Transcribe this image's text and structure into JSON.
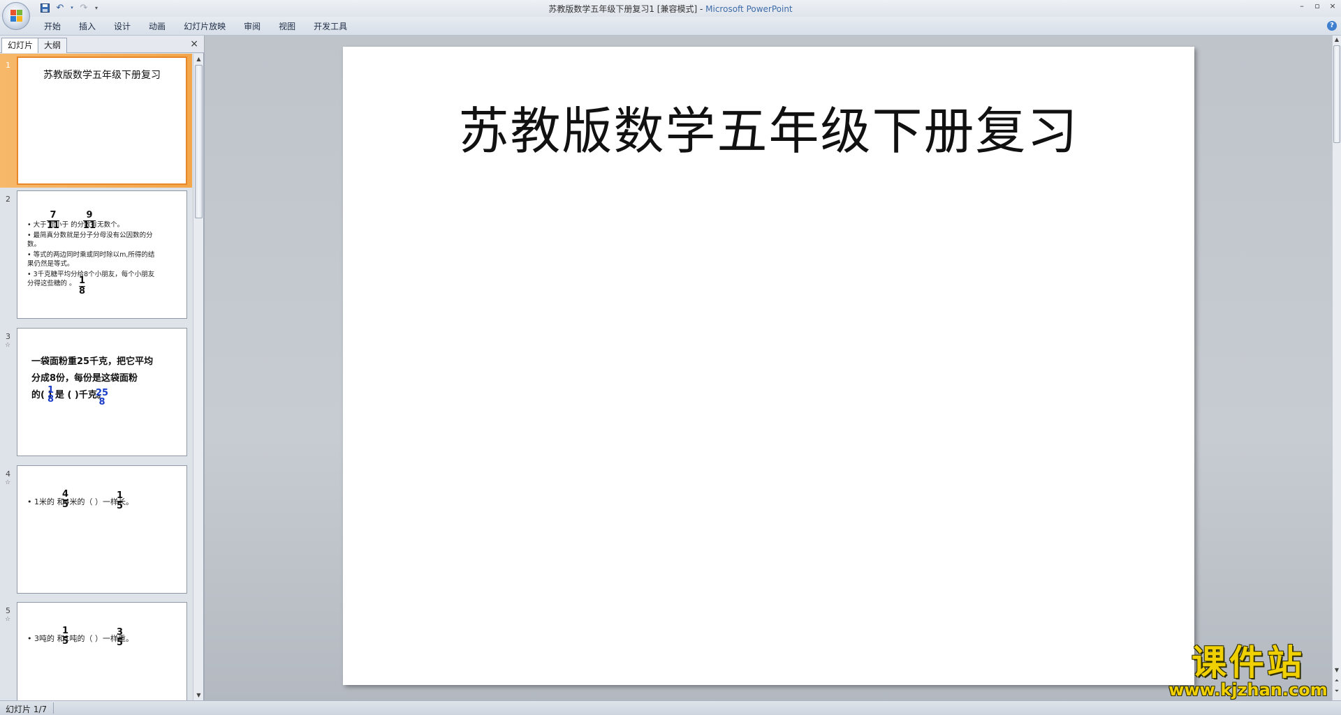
{
  "window": {
    "title_doc": "苏教版数学五年级下册复习1 [兼容模式] - ",
    "title_app": "Microsoft PowerPoint",
    "controls": [
      "–",
      "▫",
      "×"
    ]
  },
  "ribbon": {
    "tabs": [
      "开始",
      "插入",
      "设计",
      "动画",
      "幻灯片放映",
      "审阅",
      "视图",
      "开发工具"
    ],
    "help": "?"
  },
  "left_pane": {
    "tabs": [
      "幻灯片",
      "大纲"
    ],
    "close": "×",
    "thumbnails": [
      {
        "number": "1",
        "title": "苏教版数学五年级下册复习"
      },
      {
        "number": "2",
        "lines": [
          "• 大于      而小于      的分数有无数个。",
          "• 最简真分数就是分子分母没有公因数的分",
          "   数。",
          "• 等式的两边同时乘或同时除以m,所得的结",
          "   果仍然是等式。",
          "• 3千克糖平均分给8个小朋友，每个小朋友",
          "   分得这些糖的    。"
        ],
        "fractions": [
          [
            "7",
            "11"
          ],
          [
            "9",
            "11"
          ],
          [
            "1",
            "8"
          ]
        ]
      },
      {
        "number": "3",
        "star": "☆",
        "lines": [
          "一袋面粉重25千克，把它平均",
          "分成8份，每份是这袋面粉",
          "的(      ) 是 (       )千克。"
        ],
        "fractions": [
          [
            "1",
            "8"
          ],
          [
            "25",
            "8"
          ]
        ]
      },
      {
        "number": "4",
        "star": "☆",
        "text": "• 1米的      和4米的（      ）一样长。",
        "fractions": [
          [
            "4",
            "5"
          ],
          [
            "1",
            "5"
          ]
        ]
      },
      {
        "number": "5",
        "star": "☆",
        "text": "• 3吨的      和1吨的（      ）一样重。",
        "fractions": [
          [
            "1",
            "5"
          ],
          [
            "3",
            "5"
          ]
        ]
      }
    ]
  },
  "slide": {
    "title": "苏教版数学五年级下册复习"
  },
  "status_bar": {
    "text": "幻灯片 1/7"
  },
  "watermark": {
    "title": "课件站",
    "url": "www.kjzhan.com"
  },
  "colors": {
    "accent_selected": "#f4a64a",
    "fraction_blue": "#1a3cc8",
    "watermark_yellow": "#f0d000"
  }
}
